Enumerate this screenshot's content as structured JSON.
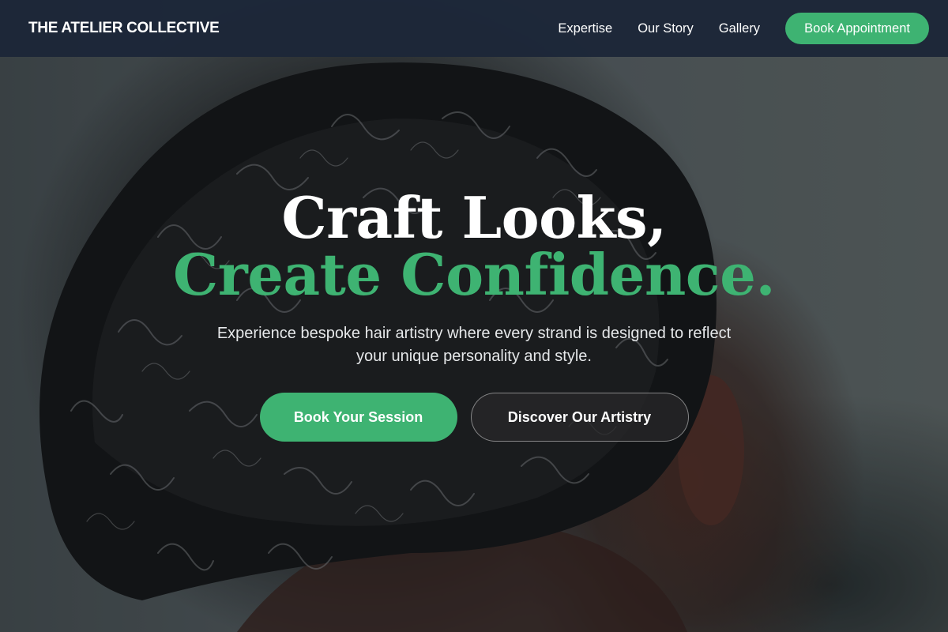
{
  "nav": {
    "logo": "THE ATELIER COLLECTIVE",
    "links": [
      "Expertise",
      "Our Story",
      "Gallery"
    ],
    "cta_label": "Book Appointment"
  },
  "hero": {
    "headline_line1": "Craft Looks,",
    "headline_line2": "Create Confidence.",
    "subtitle": "Experience bespoke hair artistry where every strand is designed to reflect your unique personality and style.",
    "primary_button": "Book Your Session",
    "secondary_button": "Discover Our Artistry",
    "background_image": "man-curly-hair-photo"
  },
  "colors": {
    "accent": "#3eb372",
    "nav_background": "#1c2638",
    "text_light": "#ffffff"
  }
}
